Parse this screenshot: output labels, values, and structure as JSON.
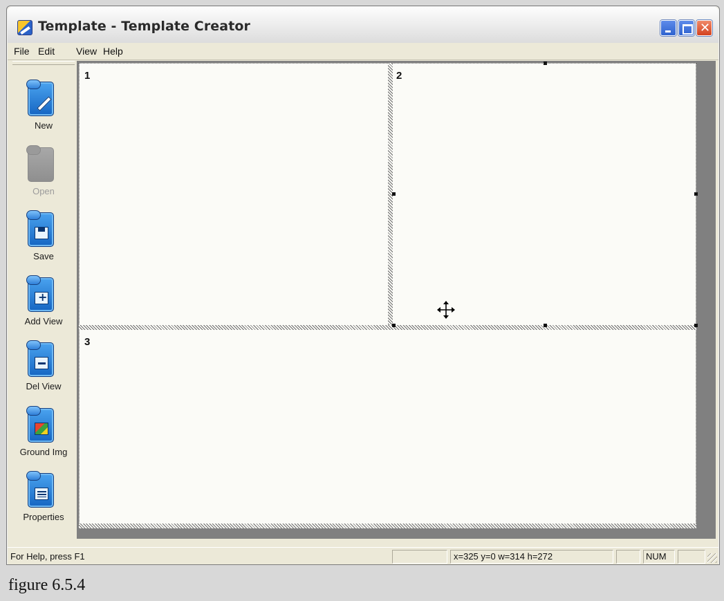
{
  "window": {
    "title": "Template - Template Creator"
  },
  "menu": [
    "File",
    "Edit",
    "View",
    "Help"
  ],
  "toolbar": {
    "items": [
      {
        "label": "New",
        "icon": "new-pencil-icon",
        "enabled": true
      },
      {
        "label": "Open",
        "icon": "open-folder-icon",
        "enabled": false
      },
      {
        "label": "Save",
        "icon": "save-disk-icon",
        "enabled": true
      },
      {
        "label": "Add View",
        "icon": "add-view-icon",
        "enabled": true
      },
      {
        "label": "Del View",
        "icon": "delete-view-icon",
        "enabled": true
      },
      {
        "label": "Ground Img",
        "icon": "ground-image-icon",
        "enabled": true
      },
      {
        "label": "Properties",
        "icon": "properties-icon",
        "enabled": true
      }
    ]
  },
  "canvas": {
    "views": [
      {
        "number": "1"
      },
      {
        "number": "2",
        "selected": true
      },
      {
        "number": "3"
      }
    ]
  },
  "status": {
    "help": "For Help, press F1",
    "coords": "x=325 y=0 w=314 h=272",
    "num": "NUM"
  },
  "caption": "figure 6.5.4"
}
